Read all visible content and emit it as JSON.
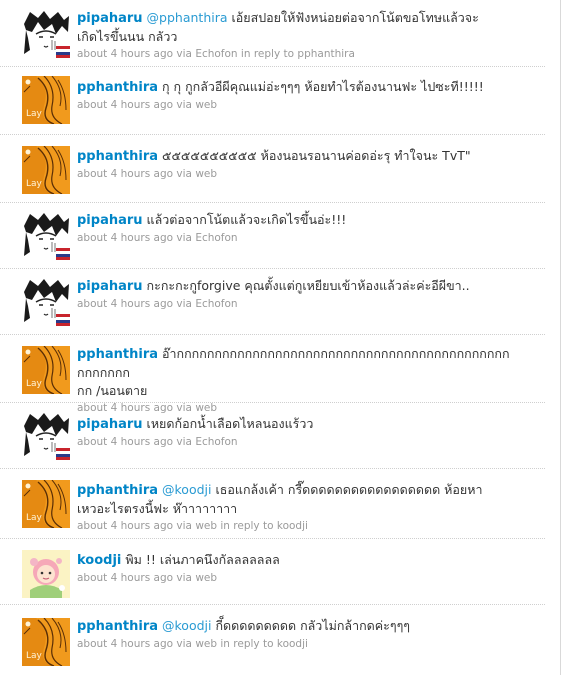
{
  "tweets": [
    {
      "avatar": "pipaharu-avatar",
      "user": "pipaharu",
      "mention": "@pphanthira",
      "text_line1": " เอ้ยสปอยให้ฟังหน่อยต่อจากโน้ตขอโทษแล้วจะ",
      "text_line2": "เกิดไรขึ้นนน กลัวว",
      "time": "about 4 hours ago",
      "via_label": "via",
      "source": "Echofon",
      "reply_label": "in reply to",
      "reply_to": "pphanthira"
    },
    {
      "avatar": "pphanthira-avatar",
      "user": "pphanthira",
      "text_line1": "กุ กุ กูกลัวอีผีคุณแม่อ่ะๆๆๆ ห้อยทำไรต้องนานฟะ ไปซะที!!!!!",
      "time": "about 4 hours ago",
      "via_label": "via",
      "source": "web"
    },
    {
      "avatar": "pphanthira-avatar",
      "user": "pphanthira",
      "text_line1": "๕๕๕๕๕๕๕๕๕๕ ห้องนอนรอนานค่อดอ่ะรุ ทำใจนะ TvT\"",
      "time": "about 4 hours ago",
      "via_label": "via",
      "source": "web"
    },
    {
      "avatar": "pipaharu-avatar",
      "user": "pipaharu",
      "text_line1": "แล้วต่อจากโน้ตแล้วจะเกิดไรขึ้นอ่ะ!!!",
      "time": "about 4 hours ago",
      "via_label": "via",
      "source": "Echofon"
    },
    {
      "avatar": "pipaharu-avatar",
      "user": "pipaharu",
      "text_line1": "กะกะกะกูforgive คุณตั้งแต่กูเหยียบเข้าห้องแล้วล่ะค่ะอีผีขา..",
      "time": "about 4 hours ago",
      "via_label": "via",
      "source": "Echofon"
    },
    {
      "avatar": "pphanthira-avatar",
      "user": "pphanthira",
      "text_line1": "อ๊ากกกกกกกกกกกกกกกกกกกกกกกกกกกกกกกกกกกกกกกกกกกกกกกกกกก",
      "text_line2": "กก /นอนตาย",
      "time": "about 4 hours ago",
      "via_label": "via",
      "source": "web"
    },
    {
      "avatar": "pipaharu-avatar",
      "user": "pipaharu",
      "text_line1": "เหยดก้อกน้ำเลือดไหลนองแร้วว",
      "time": "about 4 hours ago",
      "via_label": "via",
      "source": "Echofon"
    },
    {
      "avatar": "pphanthira-avatar",
      "user": "pphanthira",
      "mention": "@koodji",
      "text_line1": " เธอแกล้งเค้า กรี๊ดดดดดดดดดดดดดดดดด ห้อยหา",
      "text_line2": "เหวอะไรตรงนี้ฟะ ห๊าาาาาาาา",
      "time": "about 4 hours ago",
      "via_label": "via",
      "source": "web",
      "reply_label": "in reply to",
      "reply_to": "koodji"
    },
    {
      "avatar": "koodji-avatar",
      "user": "koodji",
      "text_line1": "พิม !! เล่นภาคนึงกัลลลลลลล",
      "time": "about 4 hours ago",
      "via_label": "via",
      "source": "web"
    },
    {
      "avatar": "pphanthira-avatar",
      "user": "pphanthira",
      "mention": "@koodji",
      "text_line1": " กี็ดดดดดดดดด กลัวไม่กล้ากดค่ะๆๆๆ",
      "time": "about 4 hours ago",
      "via_label": "via",
      "source": "web",
      "reply_label": "in reply to",
      "reply_to": "koodji"
    }
  ],
  "colors": {
    "screen_name": "#0085c7",
    "mention": "#2a9bd3",
    "text": "#333333",
    "meta": "#9a9a9a"
  }
}
